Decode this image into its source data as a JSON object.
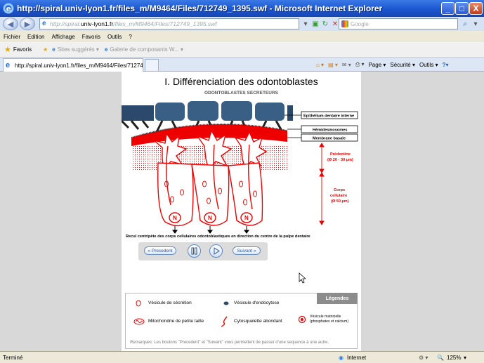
{
  "window": {
    "title": "http://spiral.univ-lyon1.fr/files_m/M9464/Files/712749_1395.swf - Microsoft Internet Explorer",
    "minimize": "_",
    "maximize": "□",
    "close": "X"
  },
  "address_bar": {
    "url_prefix": "http://spiral.",
    "url_host": "univ-lyon1.fr",
    "url_rest": "/files_m/M9464/Files/712749_1395.swf",
    "search_placeholder": "Google"
  },
  "menu": [
    "Fichier",
    "Edition",
    "Affichage",
    "Favoris",
    "Outils",
    "?"
  ],
  "favorites": {
    "label": "Favoris",
    "items": [
      "Sites suggérés ▾",
      "Galerie de composants W... ▾"
    ]
  },
  "tab": {
    "label": "http://spiral.univ-lyon1.fr/files_m/M9464/Files/71274..."
  },
  "command_bar": {
    "page": "Page ▾",
    "security": "Sécurité ▾",
    "tools": "Outils ▾"
  },
  "slide": {
    "title": "I. Différenciation des odontoblastes",
    "subtitle": "ODONTOBLASTES SECRETEURS",
    "labels": {
      "epithelium": "Epithélium dentaire interne",
      "hemidesmosomes": "Hémidesmosomes",
      "membrane": "Membrane basale",
      "predentine": "Prédentine",
      "predentine_size": "(Ø 20 - 30 µm)",
      "corps": "Corps",
      "cellulaire": "cellulaire",
      "corps_size": "(Ø 50 µm)"
    },
    "nucleus_letter": "N",
    "caption": "Recul centripète des corps cellulaires odontoblastiques en direction du centre de la pulpe dentaire",
    "controls": {
      "prev": "« Precedent",
      "next": "Suivant »"
    }
  },
  "legend": {
    "tab": "Légendes",
    "items": {
      "secretion": "Vésicule de sécrétion",
      "endocytose": "Vésicule d'endocytose",
      "mitochondrie": "Mitochondrie de petite taille",
      "cytosquelette": "Cytosquelette abondant",
      "matricielle_1": "Vésicule matricielle",
      "matricielle_2": "(phosphates et calcium)"
    },
    "remarks_label": "Remarques",
    "remarks": ": Les boutons \"Precedent\" et \"Suivant\" vous permettent de passer d'une sequence à une autre."
  },
  "status": {
    "left": "Terminé",
    "zone": "Internet",
    "zoom": "125%"
  },
  "colors": {
    "title_blue": "#1b56cf",
    "diagram_red": "#e00000",
    "epithelium_blue": "#2b4a6b"
  }
}
